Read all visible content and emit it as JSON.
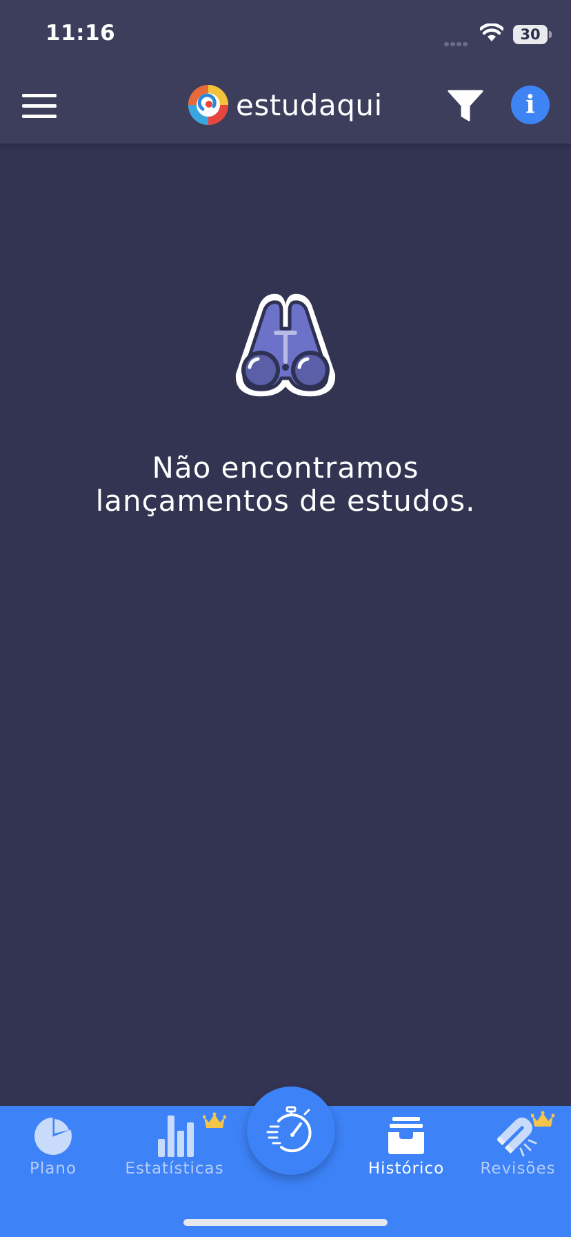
{
  "status_bar": {
    "time": "11:16",
    "battery": "30"
  },
  "header": {
    "app_name": "estudaqui",
    "info_label": "i"
  },
  "empty_state": {
    "line1": "Não encontramos",
    "line2": "lançamentos de estudos."
  },
  "tabs": [
    {
      "label": "Plano",
      "icon": "pie-chart-icon",
      "active": false,
      "premium": false
    },
    {
      "label": "Estatísticas",
      "icon": "bar-chart-icon",
      "active": false,
      "premium": true
    },
    {
      "label": "Histórico",
      "icon": "inbox-tray-icon",
      "active": true,
      "premium": false
    },
    {
      "label": "Revisões",
      "icon": "magnet-icon",
      "active": false,
      "premium": true
    }
  ],
  "fab": {
    "icon": "stopwatch-icon"
  },
  "colors": {
    "background": "#323452",
    "header": "#3c3e5c",
    "accent": "#3d82f7",
    "crown": "#f5c54a"
  }
}
